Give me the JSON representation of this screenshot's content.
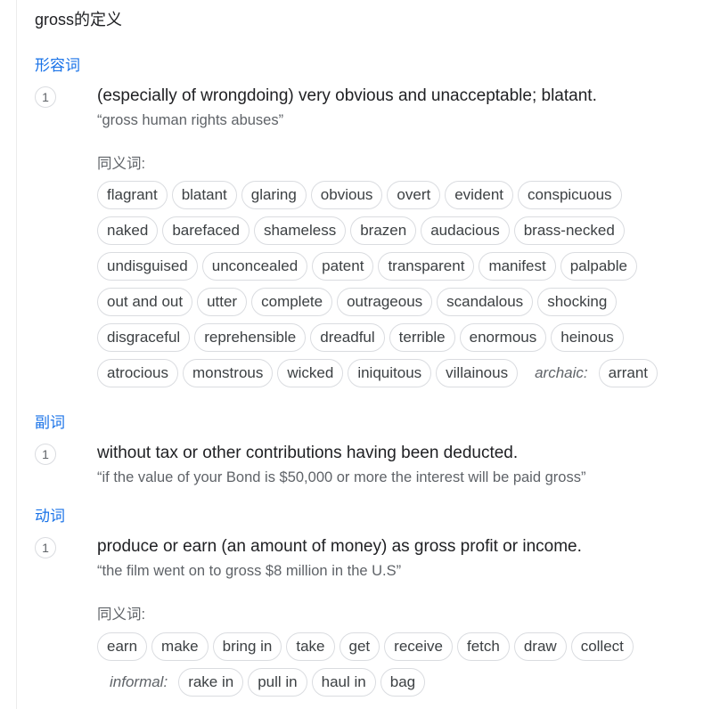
{
  "title": "gross的定义",
  "adjective": {
    "pos": "形容词",
    "sense_number": "1",
    "definition": "(especially of wrongdoing) very obvious and unacceptable; blatant.",
    "example": "“gross human rights abuses”",
    "synonyms_label": "同义词:",
    "synonym_rows": [
      [
        "flagrant",
        "blatant",
        "glaring",
        "obvious",
        "overt",
        "evident",
        "conspicuous"
      ],
      [
        "naked",
        "barefaced",
        "shameless",
        "brazen",
        "audacious",
        "brass-necked"
      ],
      [
        "undisguised",
        "unconcealed",
        "patent",
        "transparent",
        "manifest",
        "palpable"
      ],
      [
        "out and out",
        "utter",
        "complete",
        "outrageous",
        "scandalous",
        "shocking"
      ],
      [
        "disgraceful",
        "reprehensible",
        "dreadful",
        "terrible",
        "enormous",
        "heinous"
      ],
      [
        "atrocious",
        "monstrous",
        "wicked",
        "iniquitous",
        "villainous"
      ]
    ],
    "register_label": "archaic:",
    "register_synonyms": [
      "arrant"
    ]
  },
  "adverb": {
    "pos": "副词",
    "sense_number": "1",
    "definition": "without tax or other contributions having been deducted.",
    "example": "“if the value of your Bond is $50,000 or more the interest will be paid gross”"
  },
  "verb": {
    "pos": "动词",
    "sense_number": "1",
    "definition": "produce or earn (an amount of money) as gross profit or income.",
    "example": "“the film went on to gross $8 million in the U.S”",
    "synonyms_label": "同义词:",
    "synonym_rows": [
      [
        "earn",
        "make",
        "bring in",
        "take",
        "get",
        "receive",
        "fetch",
        "draw",
        "collect"
      ]
    ],
    "register_label": "informal:",
    "register_synonyms": [
      "rake in",
      "pull in",
      "haul in",
      "bag"
    ]
  }
}
